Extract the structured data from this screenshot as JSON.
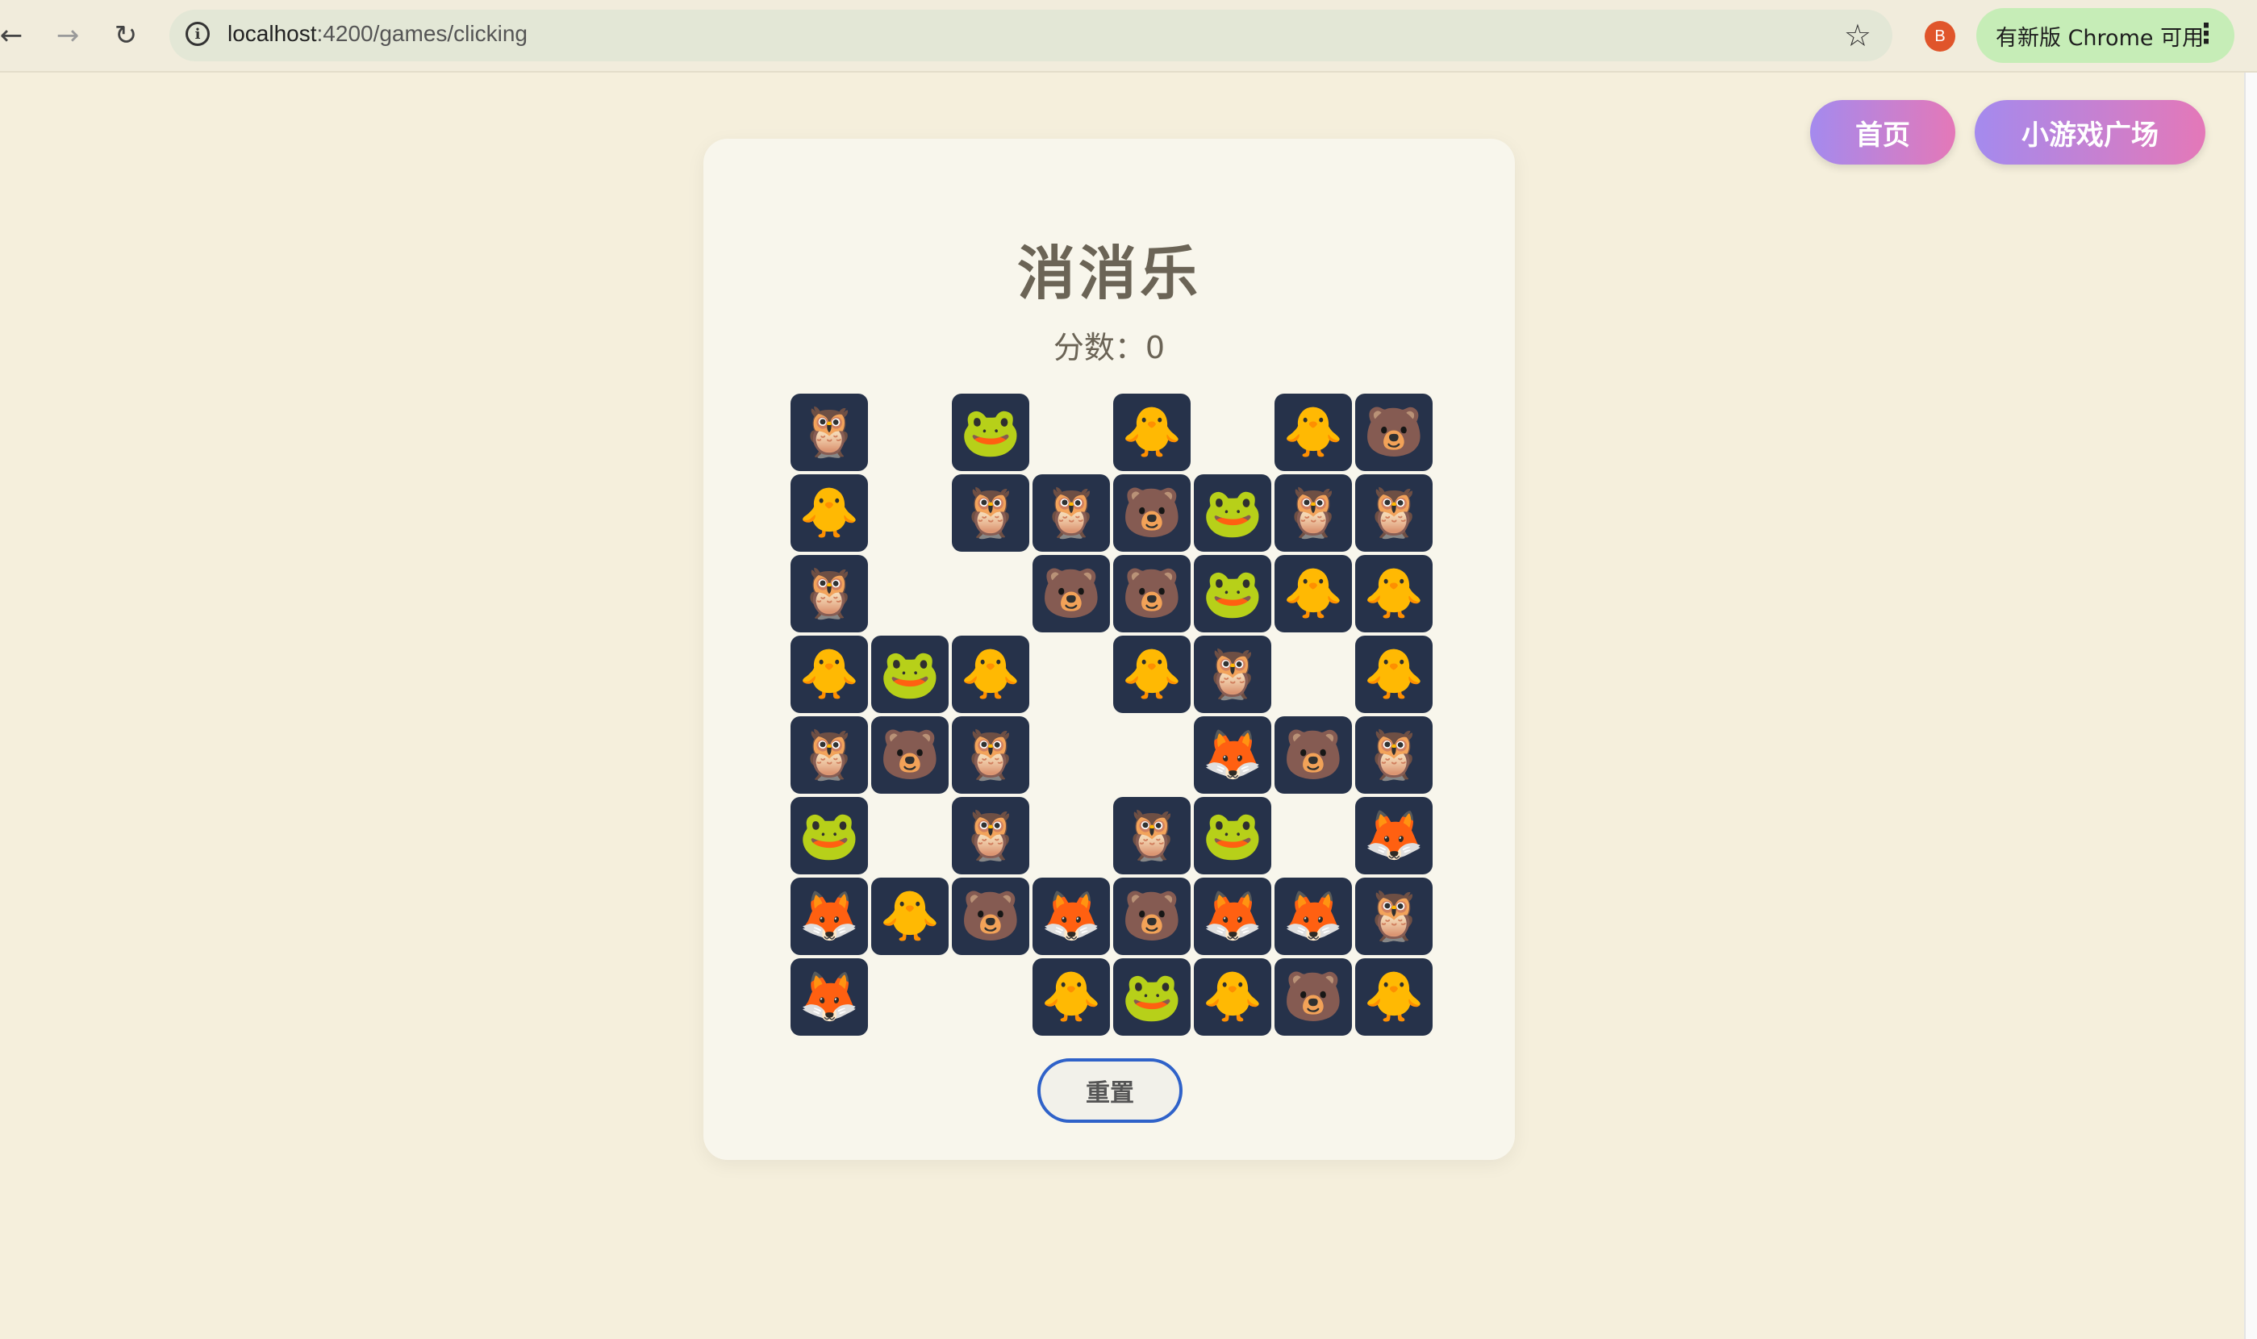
{
  "browser": {
    "url_host": "localhost",
    "url_path": ":4200/games/clicking",
    "profile_initial": "B",
    "update_label": "有新版 Chrome 可用",
    "icons": [
      "back-arrow-icon",
      "forward-arrow-icon",
      "reload-icon",
      "site-info-icon",
      "bookmark-star-icon",
      "profile-avatar",
      "more-menu-icon"
    ]
  },
  "nav": {
    "home_label": "首页",
    "games_label": "小游戏广场"
  },
  "game": {
    "title": "消消乐",
    "score_label": "分数：",
    "score_value": "0",
    "reset_label": "重置",
    "tile_icons": {
      "owl": "🦉",
      "frog": "🐸",
      "chick": "🐥",
      "bear": "🐻",
      "fox": "🦊"
    },
    "grid": [
      [
        "owl",
        null,
        "frog",
        null,
        "chick",
        null,
        "chick",
        "bear"
      ],
      [
        "chick",
        null,
        "owl",
        "owl",
        "bear",
        "frog",
        "owl",
        "owl"
      ],
      [
        "owl",
        null,
        null,
        "bear",
        "bear",
        "frog",
        "chick",
        "chick"
      ],
      [
        "chick",
        "frog",
        "chick",
        null,
        "chick",
        "owl",
        null,
        "chick"
      ],
      [
        "owl",
        "bear",
        "owl",
        null,
        null,
        "fox",
        "bear",
        "owl"
      ],
      [
        "frog",
        null,
        "owl",
        null,
        "owl",
        "frog",
        null,
        "fox"
      ],
      [
        "fox",
        "chick",
        "bear",
        "fox",
        "bear",
        "fox",
        "fox",
        "owl"
      ],
      [
        "fox",
        null,
        null,
        "chick",
        "frog",
        "chick",
        "bear",
        "chick"
      ]
    ]
  },
  "colors": {
    "page_bg": "#f5efdc",
    "card_bg": "#f8f6ec",
    "tile_bg": "#26324a",
    "title_text": "#6b6456",
    "pill_gradient_start": "#a48aee",
    "pill_gradient_end": "#e478b8",
    "reset_border": "#2f62c9",
    "update_pill_bg": "#c6edb7"
  }
}
